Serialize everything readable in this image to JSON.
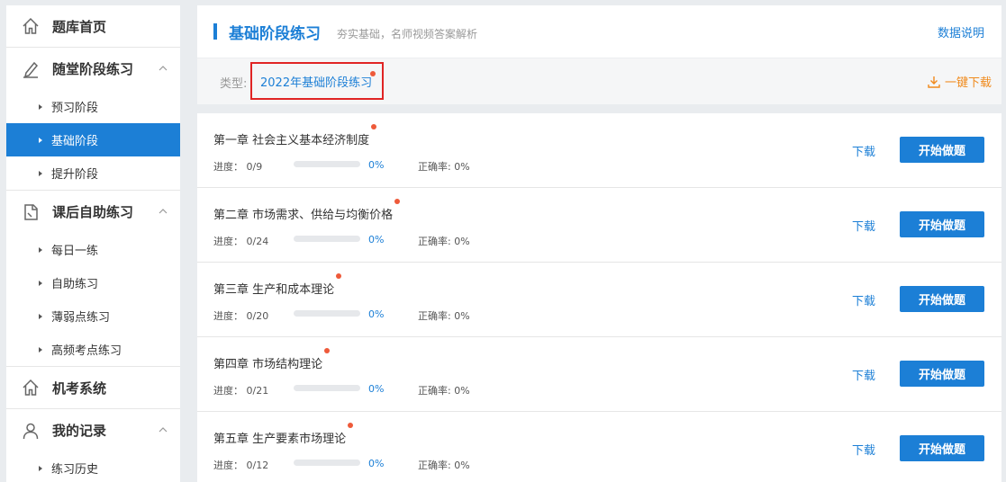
{
  "sidebar": {
    "home": {
      "label": "题库首页",
      "icon": "home-icon"
    },
    "groups": [
      {
        "label": "随堂阶段练习",
        "icon": "pen-icon",
        "items": [
          "预习阶段",
          "基础阶段",
          "提升阶段"
        ],
        "active_index": 1
      },
      {
        "label": "课后自助练习",
        "icon": "notebook-icon",
        "items": [
          "每日一练",
          "自助练习",
          "薄弱点练习",
          "高频考点练习"
        ]
      }
    ],
    "exam": {
      "label": "机考系统",
      "icon": "home-icon"
    },
    "records": {
      "label": "我的记录",
      "icon": "user-icon",
      "items": [
        "练习历史"
      ]
    }
  },
  "header": {
    "title": "基础阶段练习",
    "subtitle": "夯实基础，名师视频答案解析",
    "data_link": "数据说明",
    "type_label": "类型:",
    "type_value": "2022年基础阶段练习",
    "download_all": "一键下载"
  },
  "chapters": [
    {
      "title": "第一章 社会主义基本经济制度",
      "progress_label": "进度：",
      "progress": "0/9",
      "percent": "0%",
      "accuracy": "正确率: 0%",
      "download": "下载",
      "start": "开始做题"
    },
    {
      "title": "第二章 市场需求、供给与均衡价格",
      "progress_label": "进度：",
      "progress": "0/24",
      "percent": "0%",
      "accuracy": "正确率: 0%",
      "download": "下载",
      "start": "开始做题"
    },
    {
      "title": "第三章 生产和成本理论",
      "progress_label": "进度：",
      "progress": "0/20",
      "percent": "0%",
      "accuracy": "正确率: 0%",
      "download": "下载",
      "start": "开始做题"
    },
    {
      "title": "第四章 市场结构理论",
      "progress_label": "进度：",
      "progress": "0/21",
      "percent": "0%",
      "accuracy": "正确率: 0%",
      "download": "下载",
      "start": "开始做题"
    },
    {
      "title": "第五章 生产要素市场理论",
      "progress_label": "进度：",
      "progress": "0/12",
      "percent": "0%",
      "accuracy": "正确率: 0%",
      "download": "下载",
      "start": "开始做题"
    }
  ],
  "colors": {
    "accent": "#1c7fd6",
    "orange": "#f08a1c",
    "highlight": "#e02424",
    "dot": "#ee5a3a"
  }
}
